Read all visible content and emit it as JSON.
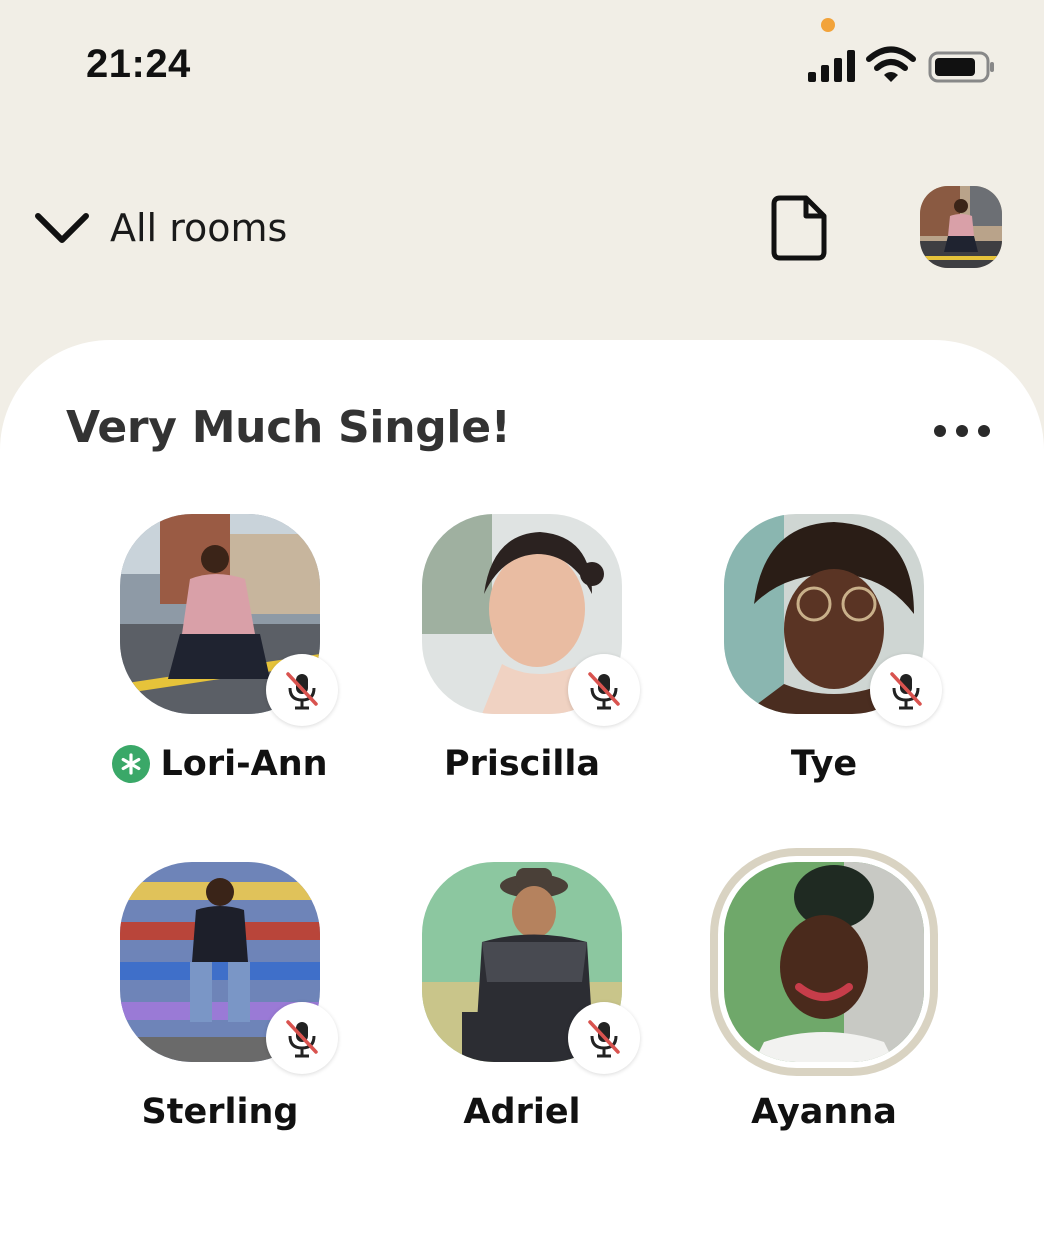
{
  "status_bar": {
    "time": "21:24",
    "signal_icon": "cellular-signal-icon",
    "wifi_icon": "wifi-icon",
    "battery_icon": "battery-icon",
    "camera_dot_color": "#f2a33a"
  },
  "header": {
    "rooms_label": "All rooms",
    "chevron_icon": "chevron-down-icon",
    "document_icon": "document-icon",
    "profile_icon": "profile-avatar"
  },
  "room": {
    "title": "Very Much Single!",
    "more_icon": "ellipsis-icon",
    "speakers": [
      {
        "name": "Lori-Ann",
        "moderator": true,
        "muted": true
      },
      {
        "name": "Priscilla",
        "moderator": false,
        "muted": true
      },
      {
        "name": "Tye",
        "moderator": false,
        "muted": true
      },
      {
        "name": "Sterling",
        "moderator": false,
        "muted": true
      },
      {
        "name": "Adriel",
        "moderator": false,
        "muted": true
      },
      {
        "name": "Ayanna",
        "moderator": false,
        "muted": false,
        "speaking": true
      }
    ]
  },
  "colors": {
    "background": "#f1eee6",
    "card": "#ffffff",
    "moderator_badge": "#3aa868",
    "mute_slash": "#d9534f",
    "speaking_ring": "#d9d3c2"
  }
}
